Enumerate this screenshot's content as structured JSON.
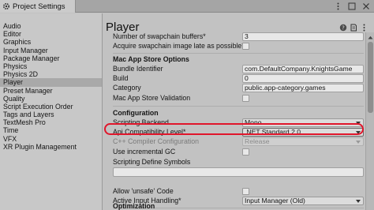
{
  "window": {
    "tab_title": "Project Settings"
  },
  "sidebar": {
    "items": [
      {
        "label": "Audio"
      },
      {
        "label": "Editor"
      },
      {
        "label": "Graphics"
      },
      {
        "label": "Input Manager"
      },
      {
        "label": "Package Manager"
      },
      {
        "label": "Physics"
      },
      {
        "label": "Physics 2D"
      },
      {
        "label": "Player",
        "active": true
      },
      {
        "label": "Preset Manager"
      },
      {
        "label": "Quality"
      },
      {
        "label": "Script Execution Order"
      },
      {
        "label": "Tags and Layers"
      },
      {
        "label": "TextMesh Pro"
      },
      {
        "label": "Time"
      },
      {
        "label": "VFX"
      },
      {
        "label": "XR Plugin Management"
      }
    ]
  },
  "main": {
    "title": "Player",
    "swapchain": {
      "label": "Number of swapchain buffers*",
      "value": "3"
    },
    "acquire_swapchain": {
      "label": "Acquire swapchain image late as possible*"
    },
    "mac_header": "Mac App Store Options",
    "bundle_id": {
      "label": "Bundle Identifier",
      "value": "com.DefaultCompany.KnightsGame"
    },
    "build": {
      "label": "Build",
      "value": "0"
    },
    "category": {
      "label": "Category",
      "value": "public.app-category.games"
    },
    "mac_validation": {
      "label": "Mac App Store Validation"
    },
    "config_header": "Configuration",
    "scripting_backend": {
      "label": "Scripting Backend",
      "value": "Mono"
    },
    "api_level": {
      "label": "Api Compatibility Level*",
      "value": ".NET Standard 2.0"
    },
    "cpp_config": {
      "label": "C++ Compiler Configuration",
      "value": "Release"
    },
    "incremental_gc": {
      "label": "Use incremental GC"
    },
    "define_symbols": {
      "label": "Scripting Define Symbols"
    },
    "unsafe_code": {
      "label": "Allow 'unsafe' Code"
    },
    "input_handling": {
      "label": "Active Input Handling*",
      "value": "Input Manager (Old)"
    },
    "optimization_header": "Optimization"
  },
  "colors": {
    "highlight_ring": "#e0162b",
    "selected_item": "#a9a9a9"
  },
  "icons": {
    "tab": "gear-icon",
    "header": [
      "help-icon",
      "preset-icon",
      "kebab-menu-icon"
    ],
    "window": [
      "kebab-menu-icon",
      "maximize-icon",
      "close-icon"
    ]
  }
}
